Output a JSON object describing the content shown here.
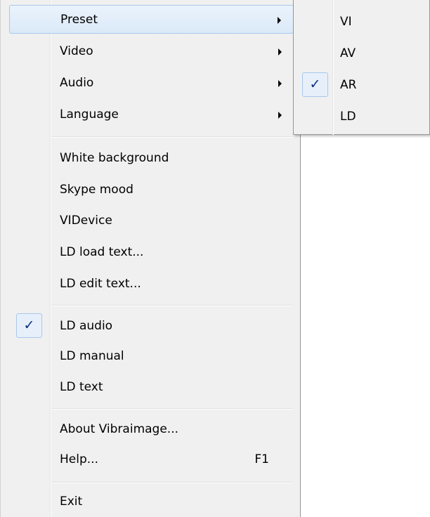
{
  "main_menu": {
    "items": [
      {
        "label": "Preset",
        "submenu": true
      },
      {
        "label": "Video",
        "submenu": true
      },
      {
        "label": "Audio",
        "submenu": true
      },
      {
        "label": "Language",
        "submenu": true
      },
      {
        "label": "White background"
      },
      {
        "label": "Skype mood"
      },
      {
        "label": "VIDevice"
      },
      {
        "label": "LD load text..."
      },
      {
        "label": "LD edit text..."
      },
      {
        "label": "LD audio",
        "checked": true
      },
      {
        "label": "LD manual"
      },
      {
        "label": "LD text"
      },
      {
        "label": "About Vibraimage..."
      },
      {
        "label": "Help...",
        "shortcut": "F1"
      },
      {
        "label": "Exit"
      }
    ],
    "check_mark": "✓"
  },
  "preset_submenu": {
    "items": [
      {
        "label": "VI"
      },
      {
        "label": "AV"
      },
      {
        "label": "AR",
        "checked": true
      },
      {
        "label": "LD"
      }
    ],
    "check_mark": "✓"
  },
  "colors": {
    "menu_bg": "#f0f0f0",
    "highlight_border": "#a8c8ec",
    "check_color": "#0b2f7f"
  }
}
